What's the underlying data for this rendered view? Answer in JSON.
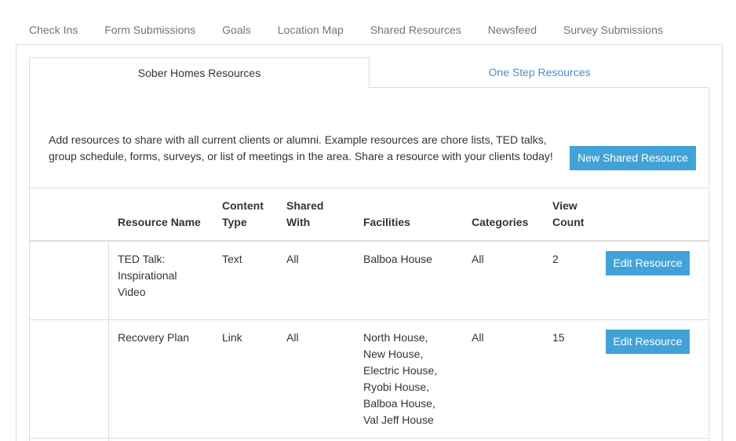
{
  "top_tabs": [
    "Check Ins",
    "Form Submissions",
    "Goals",
    "Location Map",
    "Shared Resources",
    "Newsfeed",
    "Survey Submissions"
  ],
  "sub_tabs": {
    "active": "Sober Homes Resources",
    "inactive": "One Step Resources"
  },
  "intro": {
    "text": "Add resources to share with all current clients or alumni. Example resources are chore lists, TED talks, group schedule, forms, surveys, or list of meetings in the area. Share a resource with your clients today!",
    "new_button": "New Shared Resource"
  },
  "table": {
    "headers": {
      "resource_name": "Resource Name",
      "content_type": "Content Type",
      "shared_with": "Shared With",
      "facilities": "Facilities",
      "categories": "Categories",
      "view_count": "View Count"
    },
    "rows": [
      {
        "resource_name": "TED Talk: Inspirational Video",
        "content_type": "Text",
        "shared_with": "All",
        "facilities": "Balboa House",
        "categories": "All",
        "view_count": "2",
        "edit_label": "Edit Resource"
      },
      {
        "resource_name": "Recovery Plan",
        "content_type": "Link",
        "shared_with": "All",
        "facilities": "North House, New House, Electric House, Ryobi House, Balboa House, Val Jeff House",
        "categories": "All",
        "view_count": "15",
        "edit_label": "Edit Resource"
      }
    ]
  },
  "colors": {
    "primary_button": "#41a2d8",
    "link": "#4a8cc9",
    "tab_text": "#6b7680",
    "border": "#dddddd"
  }
}
